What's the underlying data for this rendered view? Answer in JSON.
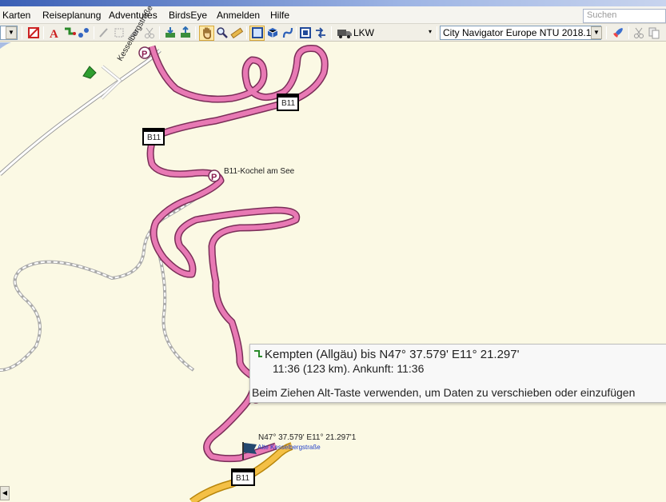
{
  "menu": {
    "items": [
      "Karten",
      "Reiseplanung",
      "Adventures",
      "BirdsEye",
      "Anmelden",
      "Hilfe"
    ]
  },
  "search": {
    "placeholder": "Suchen"
  },
  "toolbar": {
    "vehicle_profile": "LKW",
    "map_product": "City Navigator Europe NTU 2018.1"
  },
  "map": {
    "road_label": "Kesselbergstraße",
    "highway_shield": "B11",
    "poi_label": "B11-Kochel am See",
    "coordinate_label": "N47° 37.579' E11° 21.297'1",
    "flag_label": "Alte Kesselbergstraße"
  },
  "route_tooltip": {
    "summary": "Kempten (Allgäu) bis N47° 37.579' E11° 21.297'",
    "time_distance": "11:36 (123 km). Ankunft: 11:36",
    "hint": "Beim Ziehen Alt-Taste verwenden, um Daten zu verschieben oder einzufügen"
  },
  "colors": {
    "route": "#e879b4",
    "route_outline": "#7a2e58",
    "map_bg": "#fbf9e4",
    "major_road": "#f4c046"
  }
}
